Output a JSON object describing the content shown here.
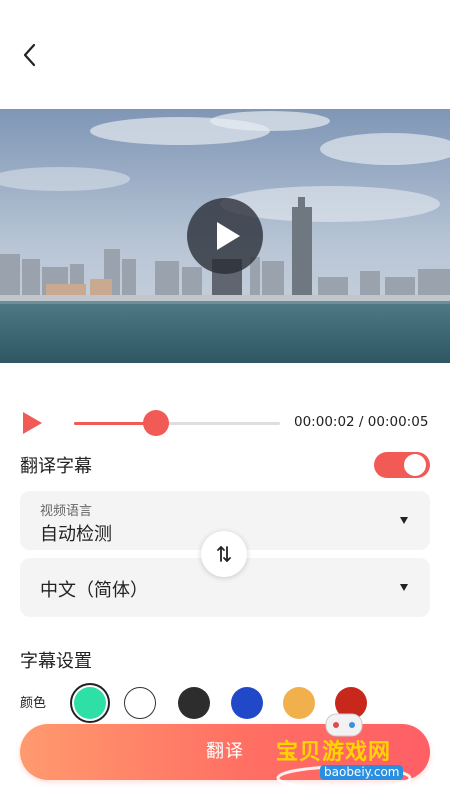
{
  "nav": {
    "back_icon": "chevron-left-icon"
  },
  "video": {
    "play_icon": "play-icon"
  },
  "player": {
    "play_icon": "play-icon",
    "progress": 0.4,
    "current_time": "00:00:02",
    "separator": " / ",
    "total_time": "00:00:05",
    "accent_color": "#f25a55"
  },
  "translate": {
    "title": "翻译字幕",
    "enabled": true,
    "source": {
      "label": "视频语言",
      "value": "自动检测"
    },
    "target": {
      "value": "中文（简体）"
    },
    "swap_icon": "swap-vertical-icon"
  },
  "settings": {
    "title": "字幕设置",
    "color_label": "颜色",
    "colors": [
      "#2ee0a6",
      "#ffffff",
      "#2d2d2d",
      "#2048c9",
      "#f2b04c",
      "#c8281c"
    ],
    "selected_color": "#2ee0a6"
  },
  "action": {
    "translate_label": "翻译"
  },
  "watermark": {
    "text": "宝贝游戏网",
    "url": "baobeiy.com"
  }
}
